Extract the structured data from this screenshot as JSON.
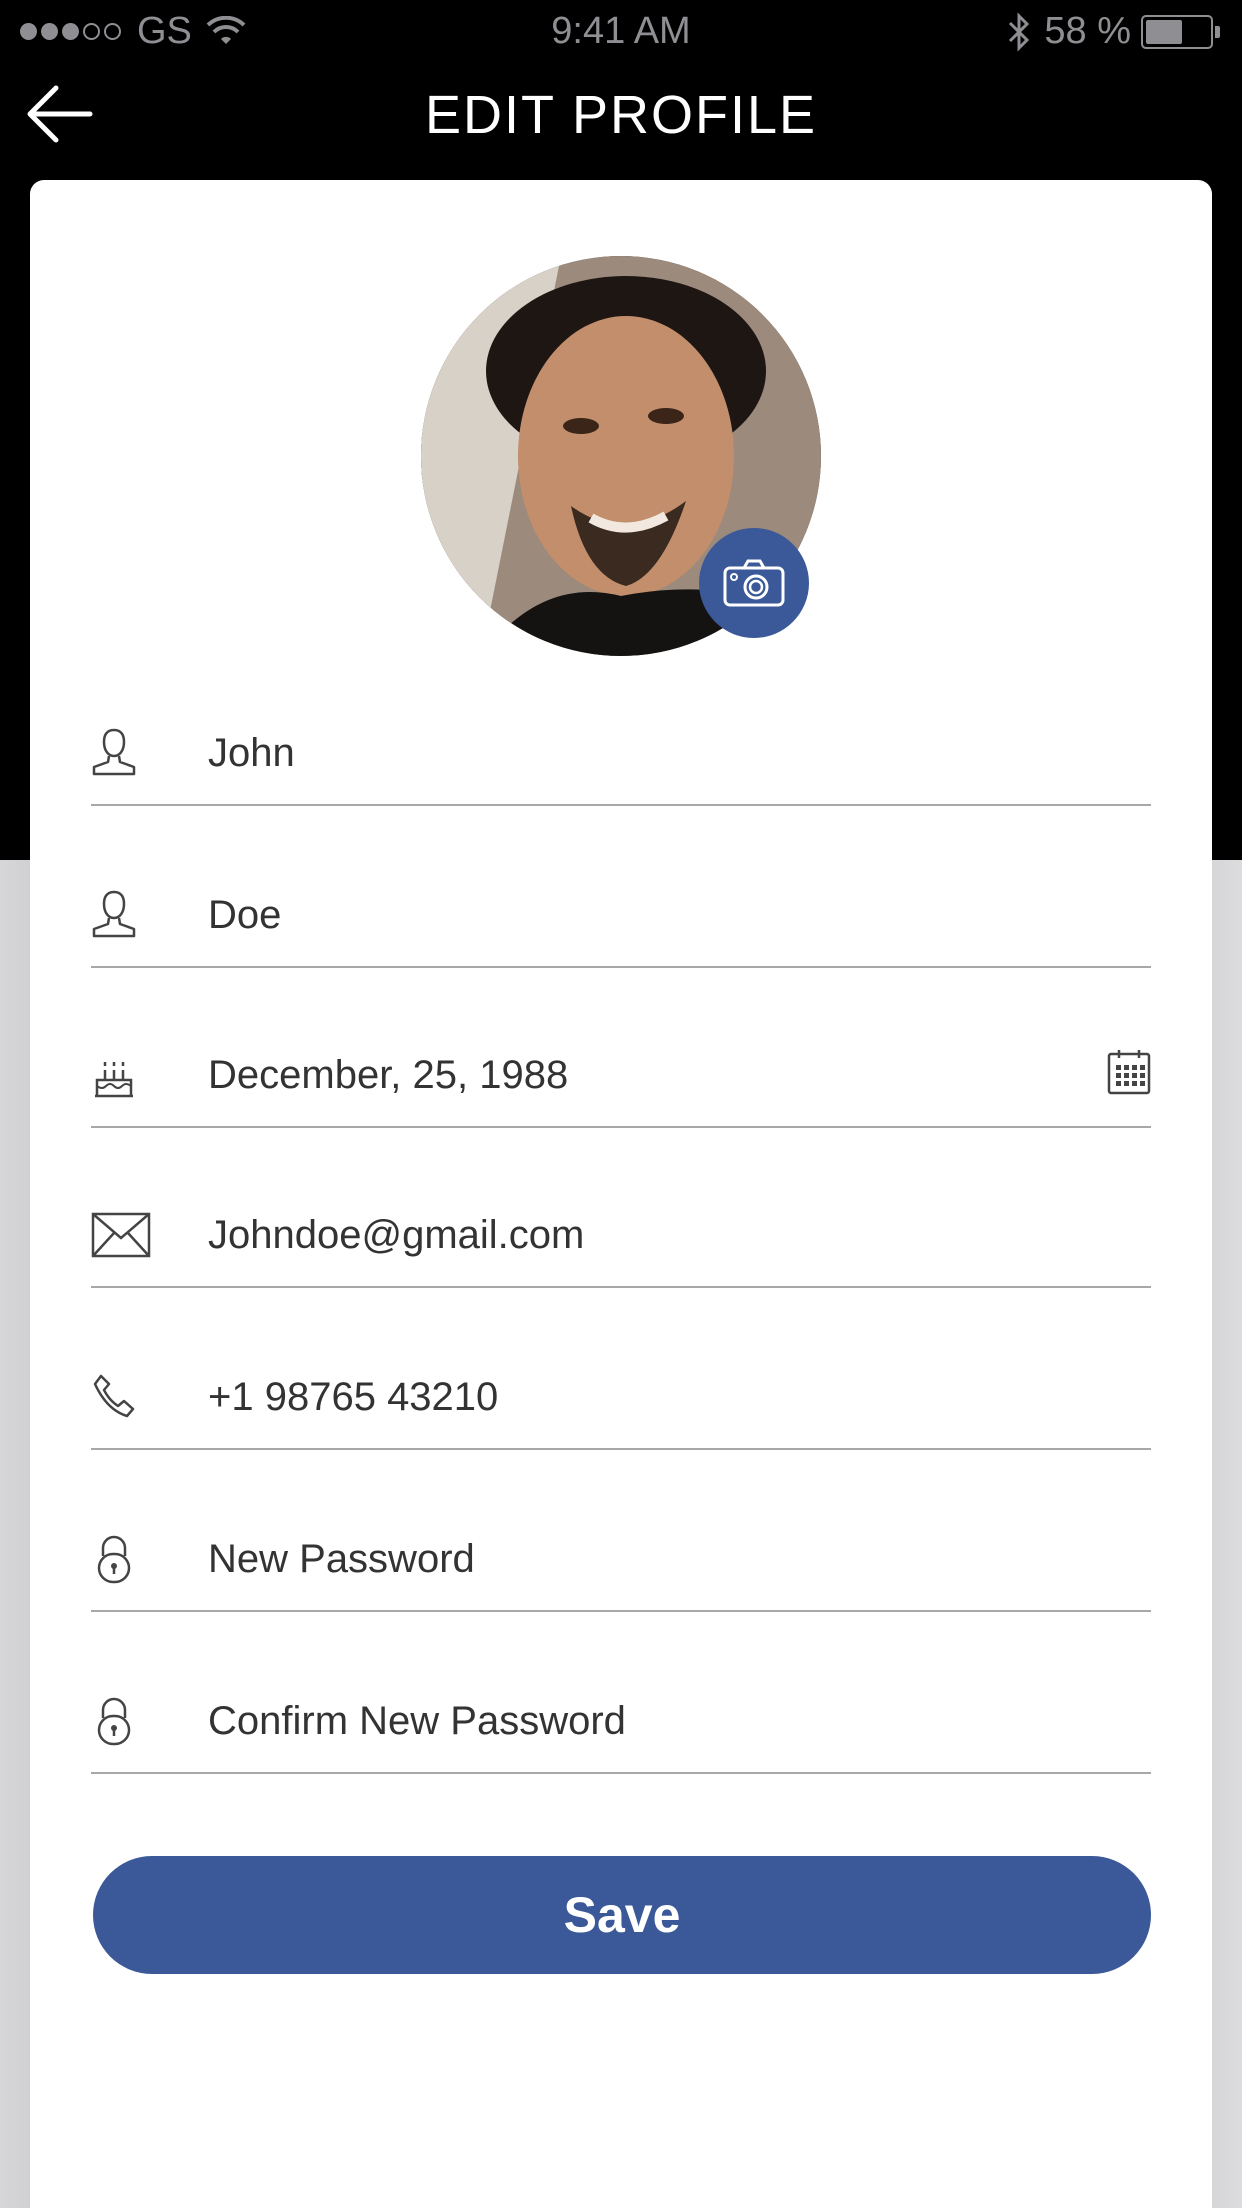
{
  "status_bar": {
    "carrier": "GS",
    "time": "9:41 AM",
    "battery": "58 %",
    "signal_bars_filled": 3,
    "signal_bars_total": 5,
    "battery_level": 0.58
  },
  "header": {
    "title": "EDIT PROFILE"
  },
  "profile": {
    "photo_icon": "camera-icon"
  },
  "form": {
    "first_name": {
      "value": "John",
      "icon": "user-icon"
    },
    "last_name": {
      "value": "Doe",
      "icon": "user-icon"
    },
    "birthday": {
      "value": "December, 25, 1988",
      "icon": "birthday-cake-icon",
      "right_icon": "calendar-icon"
    },
    "email": {
      "value": "Johndoe@gmail.com",
      "icon": "envelope-icon"
    },
    "phone": {
      "value": "+1 98765 43210",
      "icon": "phone-icon"
    },
    "new_password": {
      "placeholder": "New Password",
      "icon": "lock-icon"
    },
    "confirm_password": {
      "placeholder": "Confirm New Password",
      "icon": "lock-icon"
    }
  },
  "save_label": "Save",
  "colors": {
    "accent": "#3b5998",
    "header_bg": "#000000",
    "text": "#333333",
    "divider": "#a8a8a8"
  }
}
